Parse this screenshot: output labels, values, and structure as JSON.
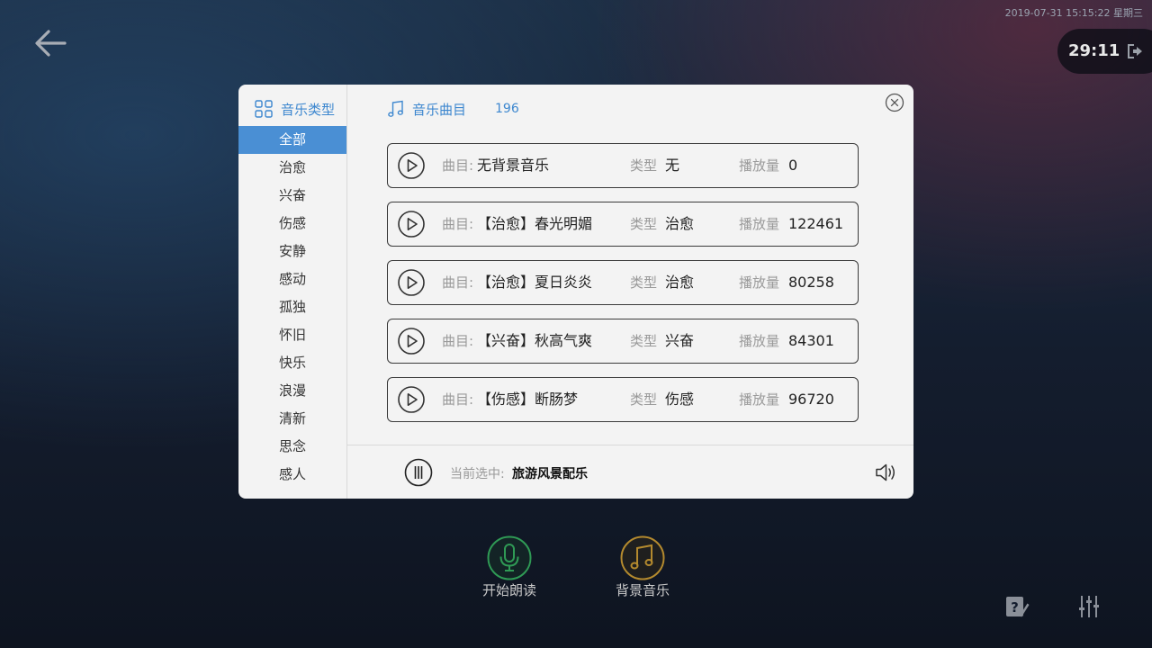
{
  "status": {
    "datetime": "2019-07-31 15:15:22 星期三"
  },
  "timer": {
    "text": "29:11"
  },
  "dialog": {
    "sidebar": {
      "header": "音乐类型",
      "categories": [
        "全部",
        "治愈",
        "兴奋",
        "伤感",
        "安静",
        "感动",
        "孤独",
        "怀旧",
        "快乐",
        "浪漫",
        "清新",
        "思念",
        "感人"
      ],
      "active_index": 0
    },
    "main": {
      "header": "音乐曲目",
      "count": "196",
      "labels": {
        "title": "曲目:",
        "type": "类型",
        "plays": "播放量"
      },
      "songs": [
        {
          "title": "无背景音乐",
          "type": "无",
          "plays": "0"
        },
        {
          "title": "【治愈】春光明媚",
          "type": "治愈",
          "plays": "122461"
        },
        {
          "title": "【治愈】夏日炎炎",
          "type": "治愈",
          "plays": "80258"
        },
        {
          "title": "【兴奋】秋高气爽",
          "type": "兴奋",
          "plays": "84301"
        },
        {
          "title": "【伤感】断肠梦",
          "type": "伤感",
          "plays": "96720"
        }
      ]
    },
    "footer": {
      "current_label": "当前选中:",
      "current_value": "旅游风景配乐"
    }
  },
  "actions": {
    "start_reading": "开始朗读",
    "background_music": "背景音乐"
  },
  "colors": {
    "accent": "#4a8fd4",
    "mic_green": "#2f9a55",
    "music_gold": "#b48a2e"
  }
}
